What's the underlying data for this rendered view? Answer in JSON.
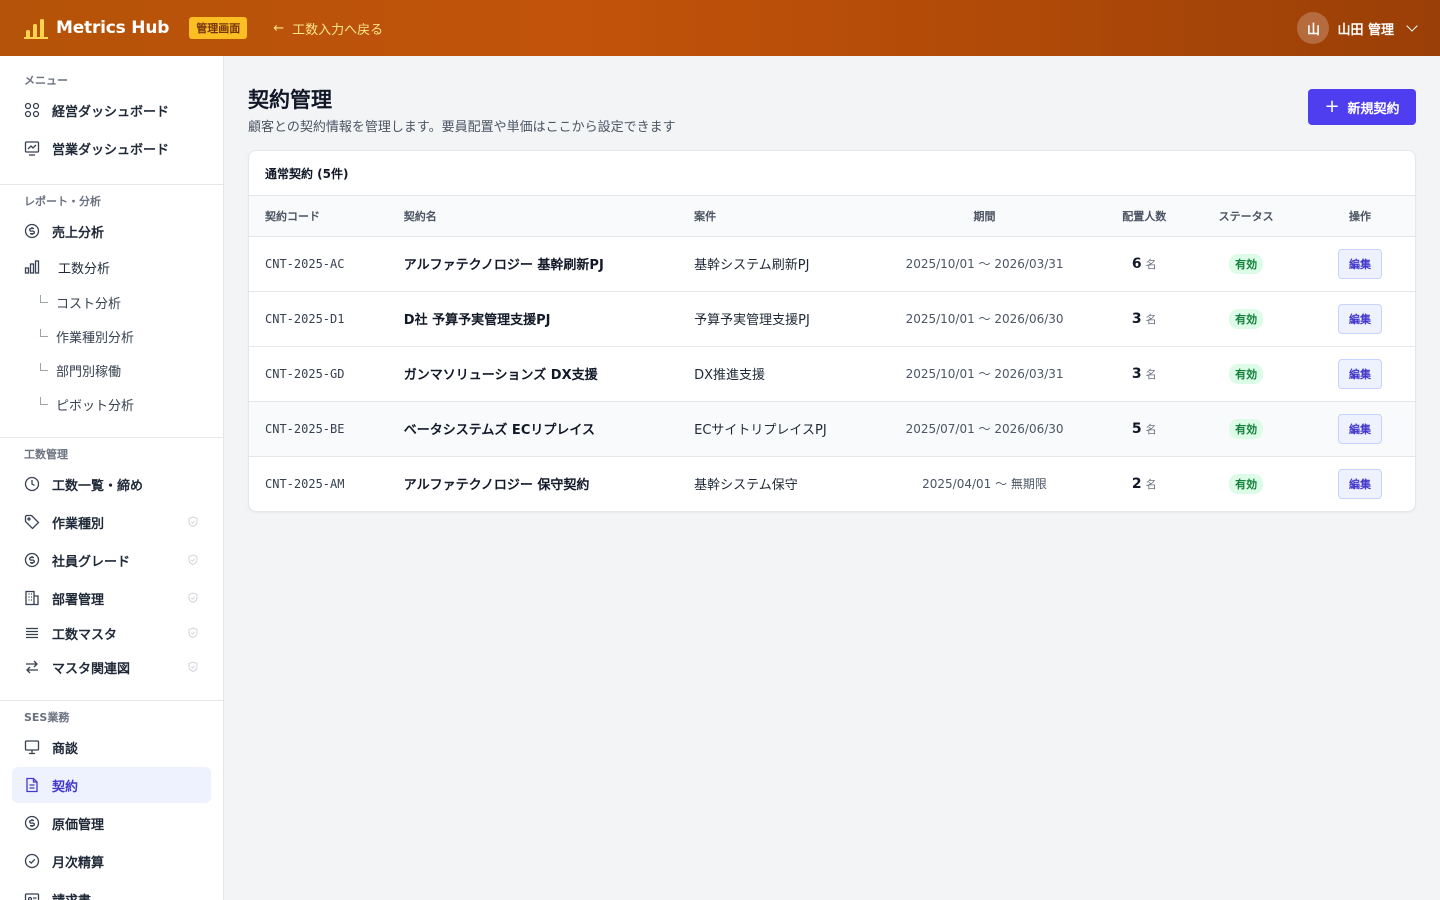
{
  "header": {
    "app_name": "Metrics Hub",
    "admin_badge": "管理画面",
    "back_link": "工数入力へ戻る",
    "user_initial": "山",
    "user_name": "山田 管理"
  },
  "sidebar": {
    "sections": [
      {
        "label": "メニュー",
        "items": [
          {
            "label": "経営ダッシュボード",
            "icon": "grid-icon"
          },
          {
            "label": "営業ダッシュボード",
            "icon": "chart-board-icon"
          }
        ]
      },
      {
        "label": "レポート・分析",
        "items": [
          {
            "label": "売上分析",
            "icon": "dollar-icon"
          },
          {
            "label": "工数分析",
            "icon": "bar-chart-icon"
          }
        ],
        "subitems": [
          "コスト分析",
          "作業種別分析",
          "部門別稼働",
          "ピボット分析"
        ]
      },
      {
        "label": "工数管理",
        "items": [
          {
            "label": "工数一覧・締め",
            "icon": "clock-icon"
          },
          {
            "label": "作業種別",
            "icon": "tag-icon"
          },
          {
            "label": "社員グレード",
            "icon": "dollar-icon"
          },
          {
            "label": "部署管理",
            "icon": "building-icon"
          },
          {
            "label": "工数マスタ",
            "icon": "stack-icon"
          },
          {
            "label": "マスタ関連図",
            "icon": "arrows-icon"
          }
        ]
      },
      {
        "label": "SES業務",
        "items": [
          {
            "label": "商談",
            "icon": "presentation-icon"
          },
          {
            "label": "契約",
            "icon": "document-icon"
          },
          {
            "label": "原価管理",
            "icon": "dollar-icon"
          },
          {
            "label": "月次精算",
            "icon": "check-circle-icon"
          },
          {
            "label": "請求書",
            "icon": "invoice-icon"
          }
        ]
      }
    ]
  },
  "page": {
    "title": "契約管理",
    "subtitle": "顧客との契約情報を管理します。要員配置や単価はここから設定できます",
    "new_button": "新規契約"
  },
  "table": {
    "heading": "通常契約 (5件)",
    "columns": [
      "契約コード",
      "契約名",
      "案件",
      "期間",
      "配置人数",
      "ステータス",
      "操作"
    ],
    "unit": "名",
    "edit_label": "編集",
    "rows": [
      {
        "code": "CNT-2025-AC",
        "name": "アルファテクノロジー 基幹刷新PJ",
        "project": "基幹システム刷新PJ",
        "period": "2025/10/01 〜 2026/03/31",
        "count": "6",
        "status": "有効"
      },
      {
        "code": "CNT-2025-D1",
        "name": "D社 予算予実管理支援PJ",
        "project": "予算予実管理支援PJ",
        "period": "2025/10/01 〜 2026/06/30",
        "count": "3",
        "status": "有効"
      },
      {
        "code": "CNT-2025-GD",
        "name": "ガンマソリューションズ DX支援",
        "project": "DX推進支援",
        "period": "2025/10/01 〜 2026/03/31",
        "count": "3",
        "status": "有効"
      },
      {
        "code": "CNT-2025-BE",
        "name": "ベータシステムズ ECリプレイス",
        "project": "ECサイトリプレイスPJ",
        "period": "2025/07/01 〜 2026/06/30",
        "count": "5",
        "status": "有効"
      },
      {
        "code": "CNT-2025-AM",
        "name": "アルファテクノロジー 保守契約",
        "project": "基幹システム保守",
        "period": "2025/04/01 〜 無期限",
        "count": "2",
        "status": "有効"
      }
    ]
  },
  "colors": {
    "header": "#b45309",
    "accent": "#4f3ef0",
    "active_bg": "#eef2ff",
    "status_bg": "#dcfce7"
  }
}
